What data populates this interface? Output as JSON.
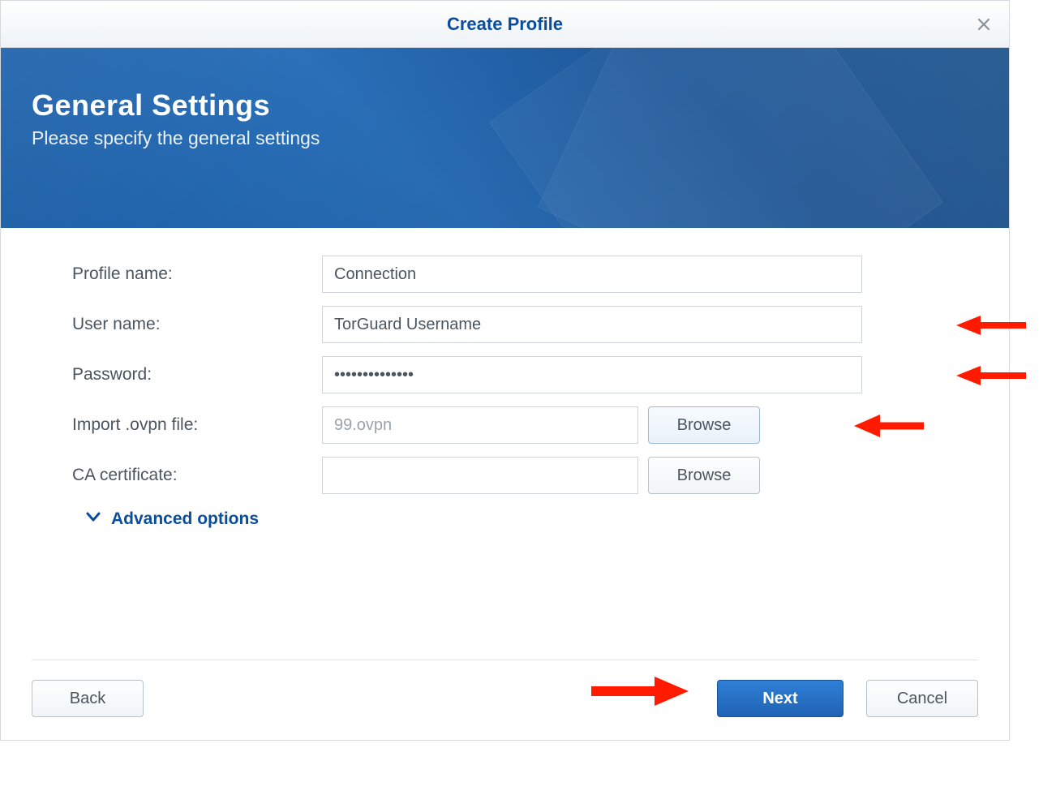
{
  "window": {
    "title": "Create Profile"
  },
  "banner": {
    "heading": "General Settings",
    "subheading": "Please specify the general settings"
  },
  "form": {
    "profile_name": {
      "label": "Profile name:",
      "value": "Connection"
    },
    "user_name": {
      "label": "User name:",
      "value": "TorGuard Username"
    },
    "password": {
      "label": "Password:",
      "value": "••••••••••••••"
    },
    "import_ovpn": {
      "label": "Import .ovpn file:",
      "value": "99.ovpn",
      "browse": "Browse"
    },
    "ca_cert": {
      "label": "CA certificate:",
      "value": "",
      "browse": "Browse"
    },
    "advanced": {
      "label": "Advanced options"
    }
  },
  "footer": {
    "back": "Back",
    "next": "Next",
    "cancel": "Cancel"
  }
}
